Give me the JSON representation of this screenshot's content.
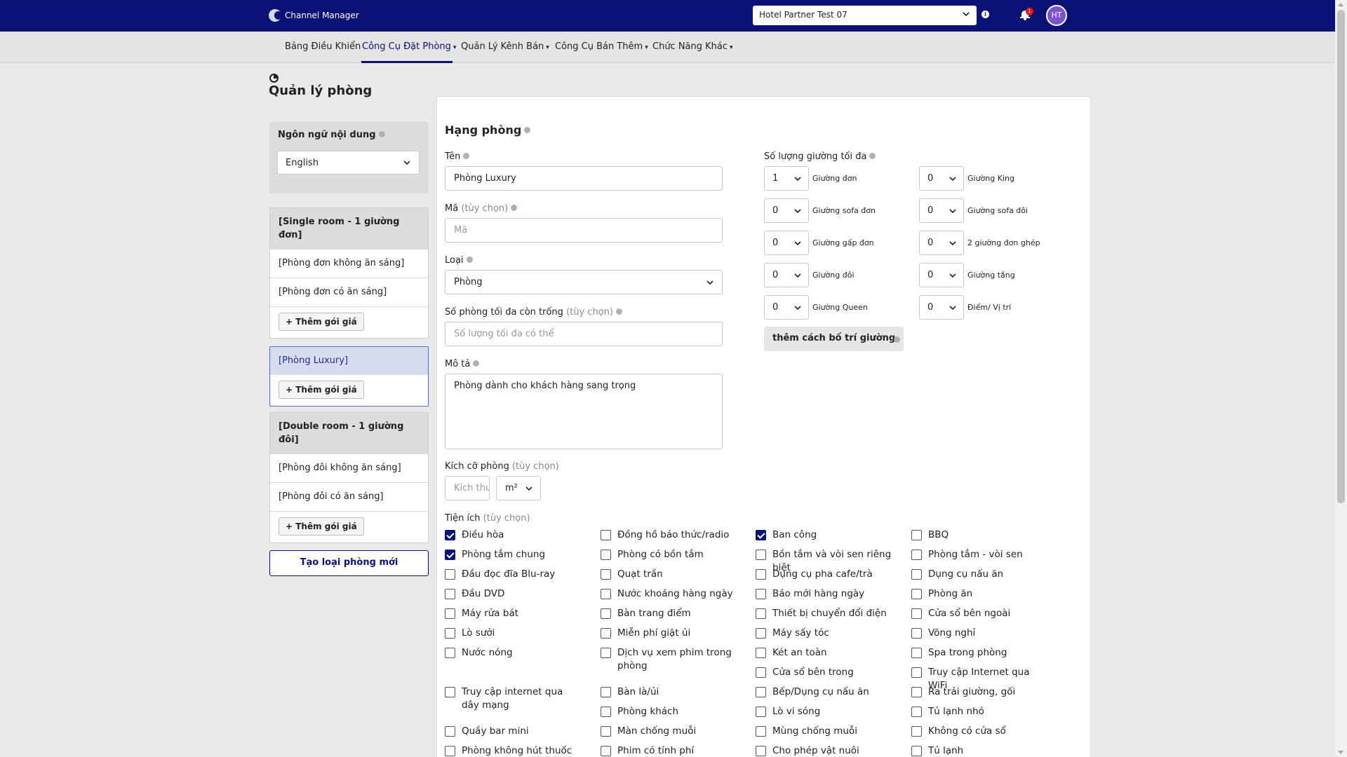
{
  "header": {
    "logo_text": "Channel Manager",
    "hotel": "Hotel Partner Test 07",
    "notification_count": "1",
    "avatar_initials": "HT"
  },
  "nav": {
    "dashboard": "Bảng Điều Khiển",
    "booking_tools": "Công Cụ Đặt Phòng",
    "channel_mgmt": "Quản Lý Kênh Bán",
    "upsell_tools": "Công Cụ Bán Thêm",
    "other": "Chức Năng Khác"
  },
  "page_title": "Quản lý phòng",
  "sidebar": {
    "lang_label": "Ngôn ngữ nội dung",
    "lang_value": "English",
    "groups": [
      {
        "header": "[Single room - 1 giường đơn]",
        "items": [
          "[Phòng đơn không ăn sáng]",
          "[Phòng đơn có ăn sáng]"
        ]
      },
      {
        "header": "[Phòng Luxury]",
        "items": []
      },
      {
        "header": "[Double room - 1 giường đôi]",
        "items": [
          "[Phòng đôi không ăn sáng]",
          "[Phòng đôi có ăn sáng]"
        ]
      }
    ],
    "add_rate_label": "Thêm gói giá",
    "create_label": "Tạo loại phòng mới"
  },
  "form": {
    "section_title": "Hạng phòng",
    "name_label": "Tên",
    "name_value": "Phòng Luxury",
    "code_label": "Mã",
    "optional": "(tùy chọn)",
    "code_placeholder": "Mã",
    "type_label": "Loại",
    "type_value": "Phòng",
    "max_rooms_label": "Số phòng tối đa còn trống",
    "max_rooms_placeholder": "Số lượng tối đa có thể",
    "desc_label": "Mô tả",
    "desc_value": "Phòng dành cho khách hàng sang trọng",
    "size_label": "Kích cỡ phòng",
    "size_placeholder": "Kích thước",
    "size_unit": "m²",
    "amenities_label": "Tiện ích",
    "beds_label": "Số lượng giường tối đa",
    "beds": [
      {
        "value": "1",
        "label": "Giường đơn"
      },
      {
        "value": "0",
        "label": "Giường King"
      },
      {
        "value": "0",
        "label": "Giường sofa đơn"
      },
      {
        "value": "0",
        "label": "Giường sofa đôi"
      },
      {
        "value": "0",
        "label": "Giường gấp đơn"
      },
      {
        "value": "0",
        "label": "2 giường đơn ghép"
      },
      {
        "value": "0",
        "label": "Giường đôi"
      },
      {
        "value": "0",
        "label": "Giường tầng"
      },
      {
        "value": "0",
        "label": "Giường Queen"
      },
      {
        "value": "0",
        "label": "Điểm/ Vị trí"
      }
    ],
    "add_bed_label": "thêm cách bố trí giường"
  },
  "amenities": [
    [
      "Điều hòa",
      "Đồng hồ báo thức/radio",
      "Ban công",
      "BBQ"
    ],
    [
      "Phòng tắm chung",
      "Phòng có bồn tắm",
      "Bồn tắm và vòi sen riêng biệt",
      "Phòng tắm - vòi sen"
    ],
    [
      "Đầu đọc đĩa Blu-ray",
      "Quạt trần",
      "Dụng cụ pha cafe/trà",
      "Dụng cụ nấu ăn"
    ],
    [
      "Đầu DVD",
      "Nước khoáng hàng ngày",
      "Báo mới hàng ngày",
      "Phòng ăn"
    ],
    [
      "Máy rửa bát",
      "Bàn trang điểm",
      "Thiết bị chuyển đổi điện",
      "Cửa sổ bên ngoài"
    ],
    [
      "Lò sưởi",
      "Miễn phí giặt ủi",
      "Máy sấy tóc",
      "Võng nghỉ"
    ],
    [
      "Nước nóng",
      "Dịch vụ xem phim trong phòng",
      "Két an toàn",
      "Spa trong phòng"
    ],
    [
      "",
      "",
      "Cửa sổ bên trong",
      "Truy cập Internet qua WiFi"
    ],
    [
      "Truy cập internet qua dây mạng",
      "Bàn là/ủi",
      "Bếp/Dụng cụ nấu ăn",
      "Ra trải giường, gối"
    ],
    [
      "",
      "Phòng khách",
      "Lò vi sóng",
      "Tủ lạnh nhỏ"
    ],
    [
      "Quầy bar mini",
      "Màn chống muỗi",
      "Mùng chống muỗi",
      "Không có cửa sổ"
    ],
    [
      "Phòng không hút thuốc",
      "Phim có tính phí",
      "Cho phép vật nuôi",
      "Tủ lạnh"
    ]
  ],
  "amenities_checked": [
    "Điều hòa",
    "Ban công",
    "Phòng tắm chung"
  ]
}
